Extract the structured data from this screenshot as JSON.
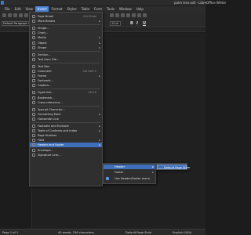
{
  "window": {
    "title": "palm tree.odt - LibreOffice Writer"
  },
  "menubar": [
    "File",
    "Edit",
    "View",
    "Insert",
    "Format",
    "Styles",
    "Table",
    "Form",
    "Tools",
    "Window",
    "Help"
  ],
  "toolbar": {
    "paragraph_style": "Default Paragraph Style",
    "font_size": "12 pt",
    "bold": "B",
    "italic": "I",
    "underline": "U"
  },
  "insert_menu": {
    "items": [
      {
        "label": "Page Break",
        "shortcut": "Ctrl+Enter"
      },
      {
        "label": "More Breaks",
        "submenu": true
      },
      {
        "sep": true
      },
      {
        "label": "Image..."
      },
      {
        "label": "Chart..."
      },
      {
        "label": "Media",
        "submenu": true
      },
      {
        "label": "Object",
        "submenu": true
      },
      {
        "label": "Shape",
        "submenu": true
      },
      {
        "sep": true
      },
      {
        "label": "Section..."
      },
      {
        "label": "Text from File..."
      },
      {
        "sep": true
      },
      {
        "label": "Text Box"
      },
      {
        "label": "Comment",
        "shortcut": "Ctrl+Alt+C"
      },
      {
        "label": "Frame",
        "submenu": true
      },
      {
        "label": "Fontwork..."
      },
      {
        "label": "Caption..."
      },
      {
        "sep": true
      },
      {
        "label": "Hyperlink...",
        "shortcut": "Ctrl+K"
      },
      {
        "label": "Bookmark..."
      },
      {
        "label": "Cross-reference..."
      },
      {
        "sep": true
      },
      {
        "label": "Special Character..."
      },
      {
        "label": "Formatting Mark",
        "submenu": true
      },
      {
        "label": "Horizontal Line"
      },
      {
        "sep": true
      },
      {
        "label": "Footnote and Endnote",
        "submenu": true
      },
      {
        "label": "Table of Contents and Index",
        "submenu": true
      },
      {
        "label": "Page Number"
      },
      {
        "label": "Field",
        "submenu": true
      },
      {
        "label": "Header and Footer",
        "submenu": true,
        "highlighted": true
      },
      {
        "label": "Envelope..."
      },
      {
        "label": "Signature Line..."
      }
    ]
  },
  "header_footer_menu": {
    "items": [
      {
        "label": "Header",
        "submenu": true,
        "highlighted": true
      },
      {
        "label": "Footer",
        "submenu": true
      },
      {
        "label": "Use Header/Footer menu",
        "checked": true
      }
    ]
  },
  "header_menu": {
    "items": [
      {
        "label": "Default Page Style"
      }
    ]
  },
  "statusbar": {
    "page": "Page 1 of 1",
    "words": "40 words, 316 characters",
    "page_style": "Default Page Style",
    "language": "English (USA)"
  }
}
